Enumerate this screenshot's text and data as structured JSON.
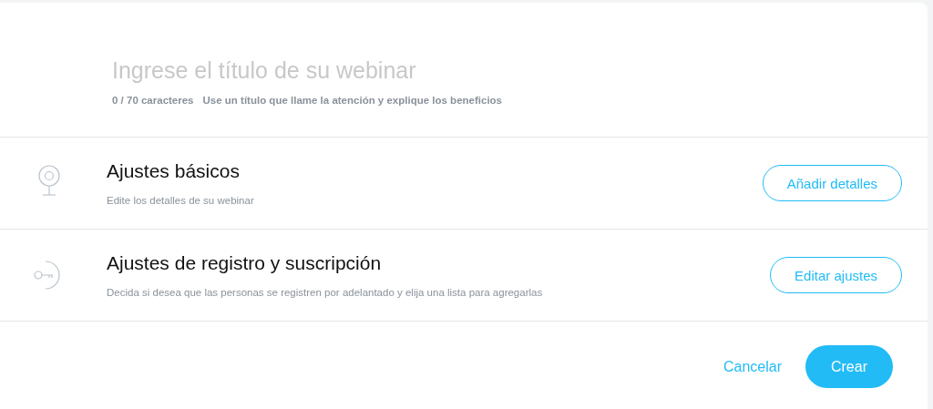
{
  "title_field": {
    "placeholder": "Ingrese el título de su webinar",
    "counter": "0 / 70 caracteres",
    "hint": "Use un título que llame la atención y explique los beneficios"
  },
  "sections": [
    {
      "kind": "webcam",
      "title": "Ajustes básicos",
      "description": "Edite los detalles de su webinar",
      "button": "Añadir detalles"
    },
    {
      "kind": "key",
      "title": "Ajustes de registro y suscripción",
      "description": "Decida si desea que las personas se registren por adelantado y elija una lista para agregarlas",
      "button": "Editar ajustes"
    }
  ],
  "footer": {
    "cancel": "Cancelar",
    "submit": "Crear"
  }
}
